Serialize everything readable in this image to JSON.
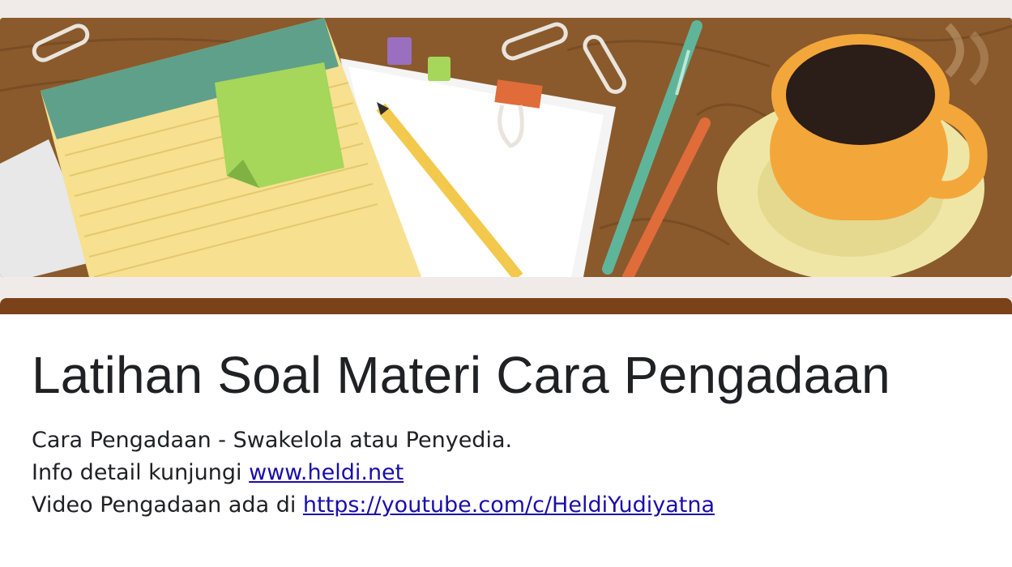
{
  "header_image": {
    "description_icon": "desk-illustration",
    "colors": {
      "wood": "#8a5a2c",
      "notepad": "#f7e08f",
      "sticky_note": "#a6d65a",
      "coffee_cup": "#f3a73a",
      "saucer": "#efe6a6",
      "accent_bar": "#7b4119"
    }
  },
  "form": {
    "title": "Latihan Soal Materi Cara Pengadaan",
    "description": {
      "line1": "Cara Pengadaan - Swakelola atau Penyedia.",
      "line2_prefix": "Info detail kunjungi ",
      "line2_link": "www.heldi.net",
      "line3_prefix": "Video Pengadaan ada di ",
      "line3_link": "https://youtube.com/c/HeldiYudiyatna"
    }
  }
}
